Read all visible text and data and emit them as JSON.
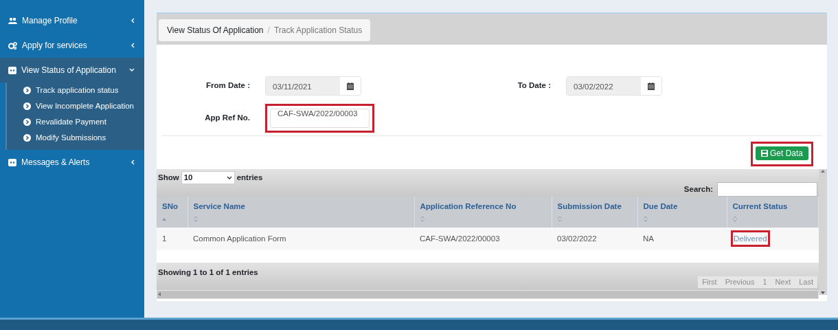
{
  "sidebar": {
    "items": [
      {
        "label": "Manage Profile",
        "expanded": false
      },
      {
        "label": "Apply for services",
        "expanded": false
      },
      {
        "label": "View Status of Application",
        "expanded": true,
        "children": [
          {
            "label": "Track application status"
          },
          {
            "label": "View Incomplete Application"
          },
          {
            "label": "Revalidate Payment"
          },
          {
            "label": "Modify Submissions"
          }
        ]
      },
      {
        "label": "Messages & Alerts",
        "expanded": false
      }
    ]
  },
  "breadcrumb": {
    "items": [
      "View Status Of Application",
      "Track Application Status"
    ],
    "separator": "/"
  },
  "form": {
    "from_date": {
      "label": "From Date :",
      "value": "03/11/2021"
    },
    "to_date": {
      "label": "To Date :",
      "value": "03/02/2022"
    },
    "app_ref": {
      "label": "App Ref No.",
      "value": "CAF-SWA/2022/00003",
      "highlighted": true
    }
  },
  "get_data_button": {
    "label": "Get Data",
    "highlighted": true
  },
  "table": {
    "show_label": "Show",
    "page_size": "10",
    "entries_label": "entries",
    "search_label": "Search:",
    "columns": [
      {
        "label": "SNo",
        "sorted": true
      },
      {
        "label": "Service Name",
        "sorted": false
      },
      {
        "label": "Application Reference No",
        "sorted": false
      },
      {
        "label": "Submission Date",
        "sorted": false
      },
      {
        "label": "Due Date",
        "sorted": false
      },
      {
        "label": "Current Status",
        "sorted": false
      }
    ],
    "rows": [
      {
        "cells": [
          "1",
          "Common Application Form",
          "CAF-SWA/2022/00003",
          "03/02/2022",
          "NA"
        ],
        "status": "Delivered",
        "status_highlighted": true
      }
    ],
    "info": "Showing 1 to 1 of 1 entries",
    "pagination": [
      {
        "label": "First",
        "disabled": true
      },
      {
        "label": "Previous",
        "disabled": true
      },
      {
        "label": "1",
        "disabled": true
      },
      {
        "label": "Next",
        "disabled": true
      },
      {
        "label": "Last",
        "disabled": true
      }
    ]
  }
}
